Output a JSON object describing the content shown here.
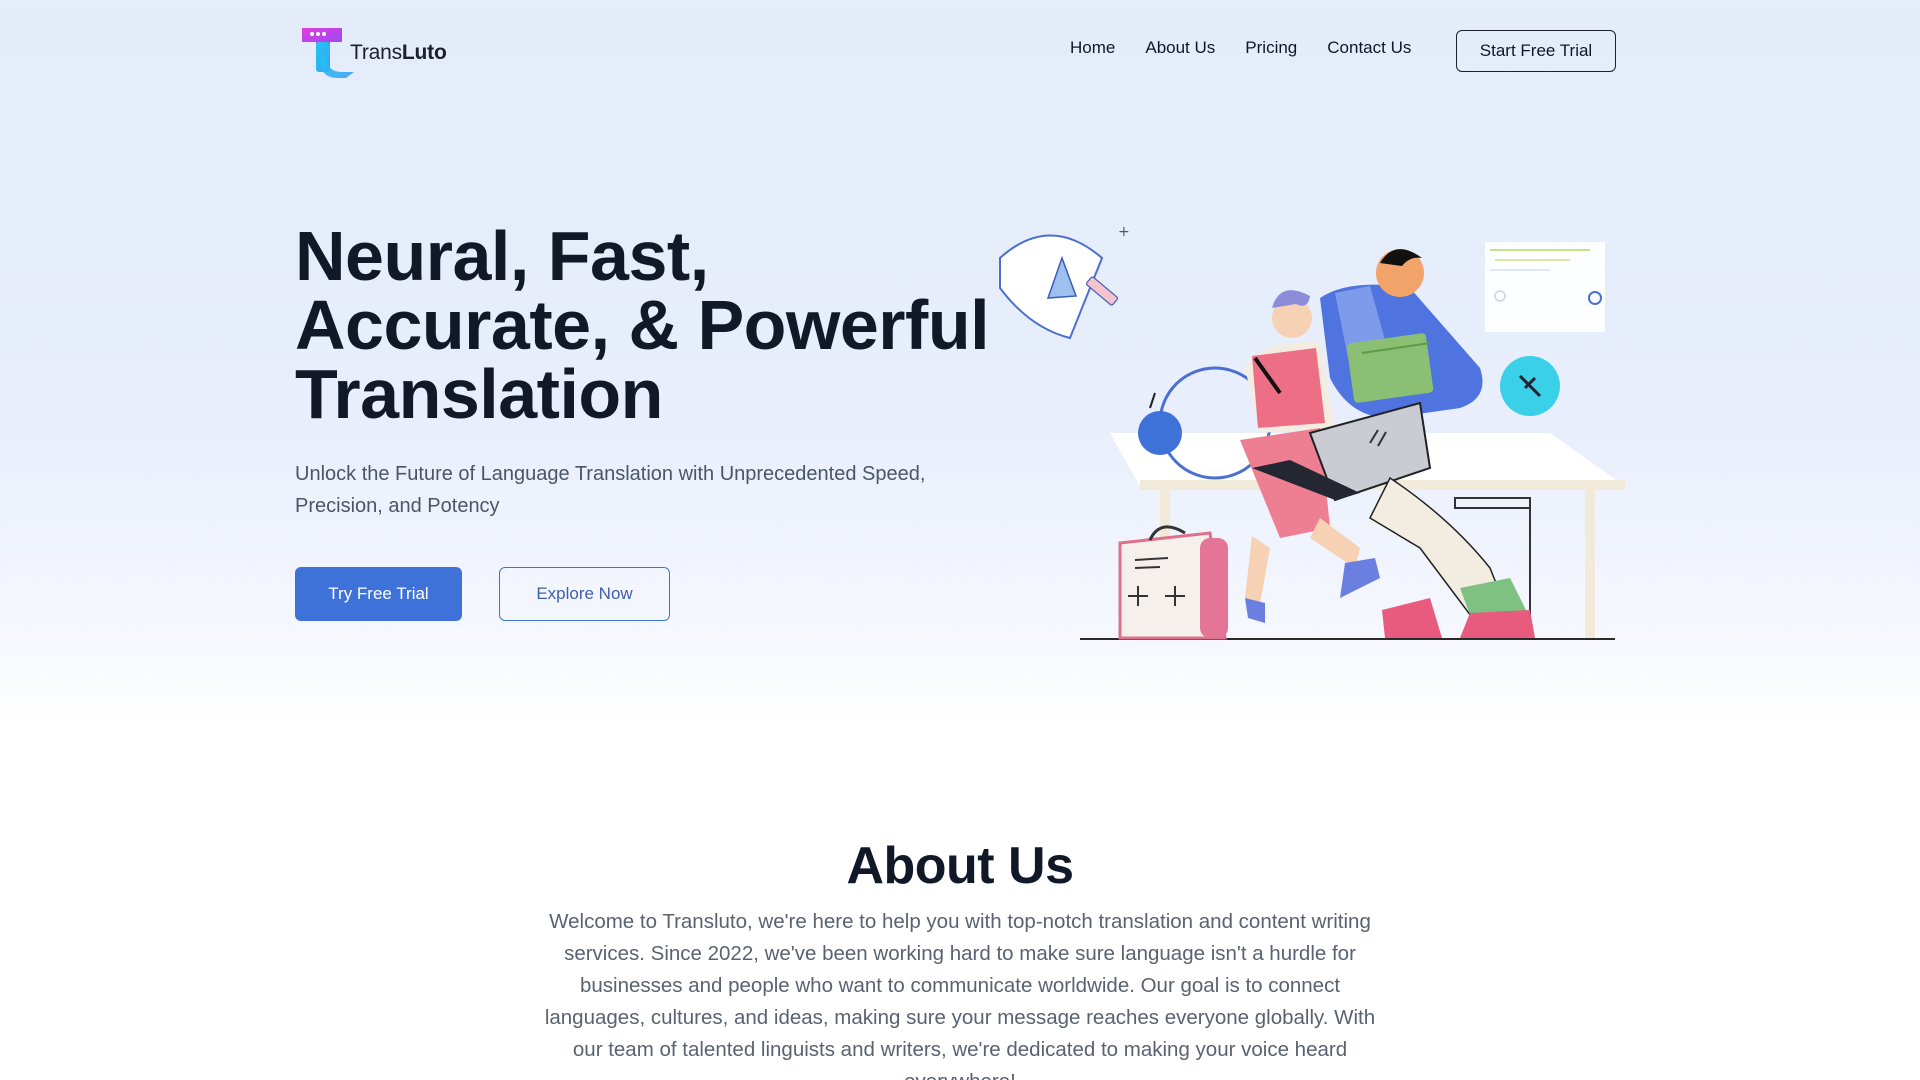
{
  "brand": {
    "name_prefix": "Trans",
    "name_suffix": "Luto",
    "logo_colors": [
      "#e23be0",
      "#22c6f0"
    ]
  },
  "nav": {
    "items": [
      "Home",
      "About Us",
      "Pricing",
      "Contact Us"
    ],
    "cta_label": "Start Free Trial"
  },
  "hero": {
    "title_lines": [
      "Neural, Fast,",
      "Accurate, & Powerful",
      "Translation"
    ],
    "subtitle": "Unlock the Future of Language Translation with Unprecedented Speed, Precision, and Potency",
    "primary_button": "Try Free Trial",
    "secondary_button": "Explore Now"
  },
  "about": {
    "title": "About Us",
    "body": "Welcome to Transluto, we're here to help you with top-notch translation and content writing services. Since 2022, we've been working hard to make sure language isn't a hurdle for businesses and people who want to communicate worldwide. Our goal is to connect languages, cultures, and ideas, making sure your message reaches everyone globally. With our team of talented linguists and writers, we're dedicated to making your voice heard everywhere!"
  },
  "colors": {
    "accent": "#3e72d9",
    "heading": "#111827",
    "body_text": "#4b5566"
  }
}
